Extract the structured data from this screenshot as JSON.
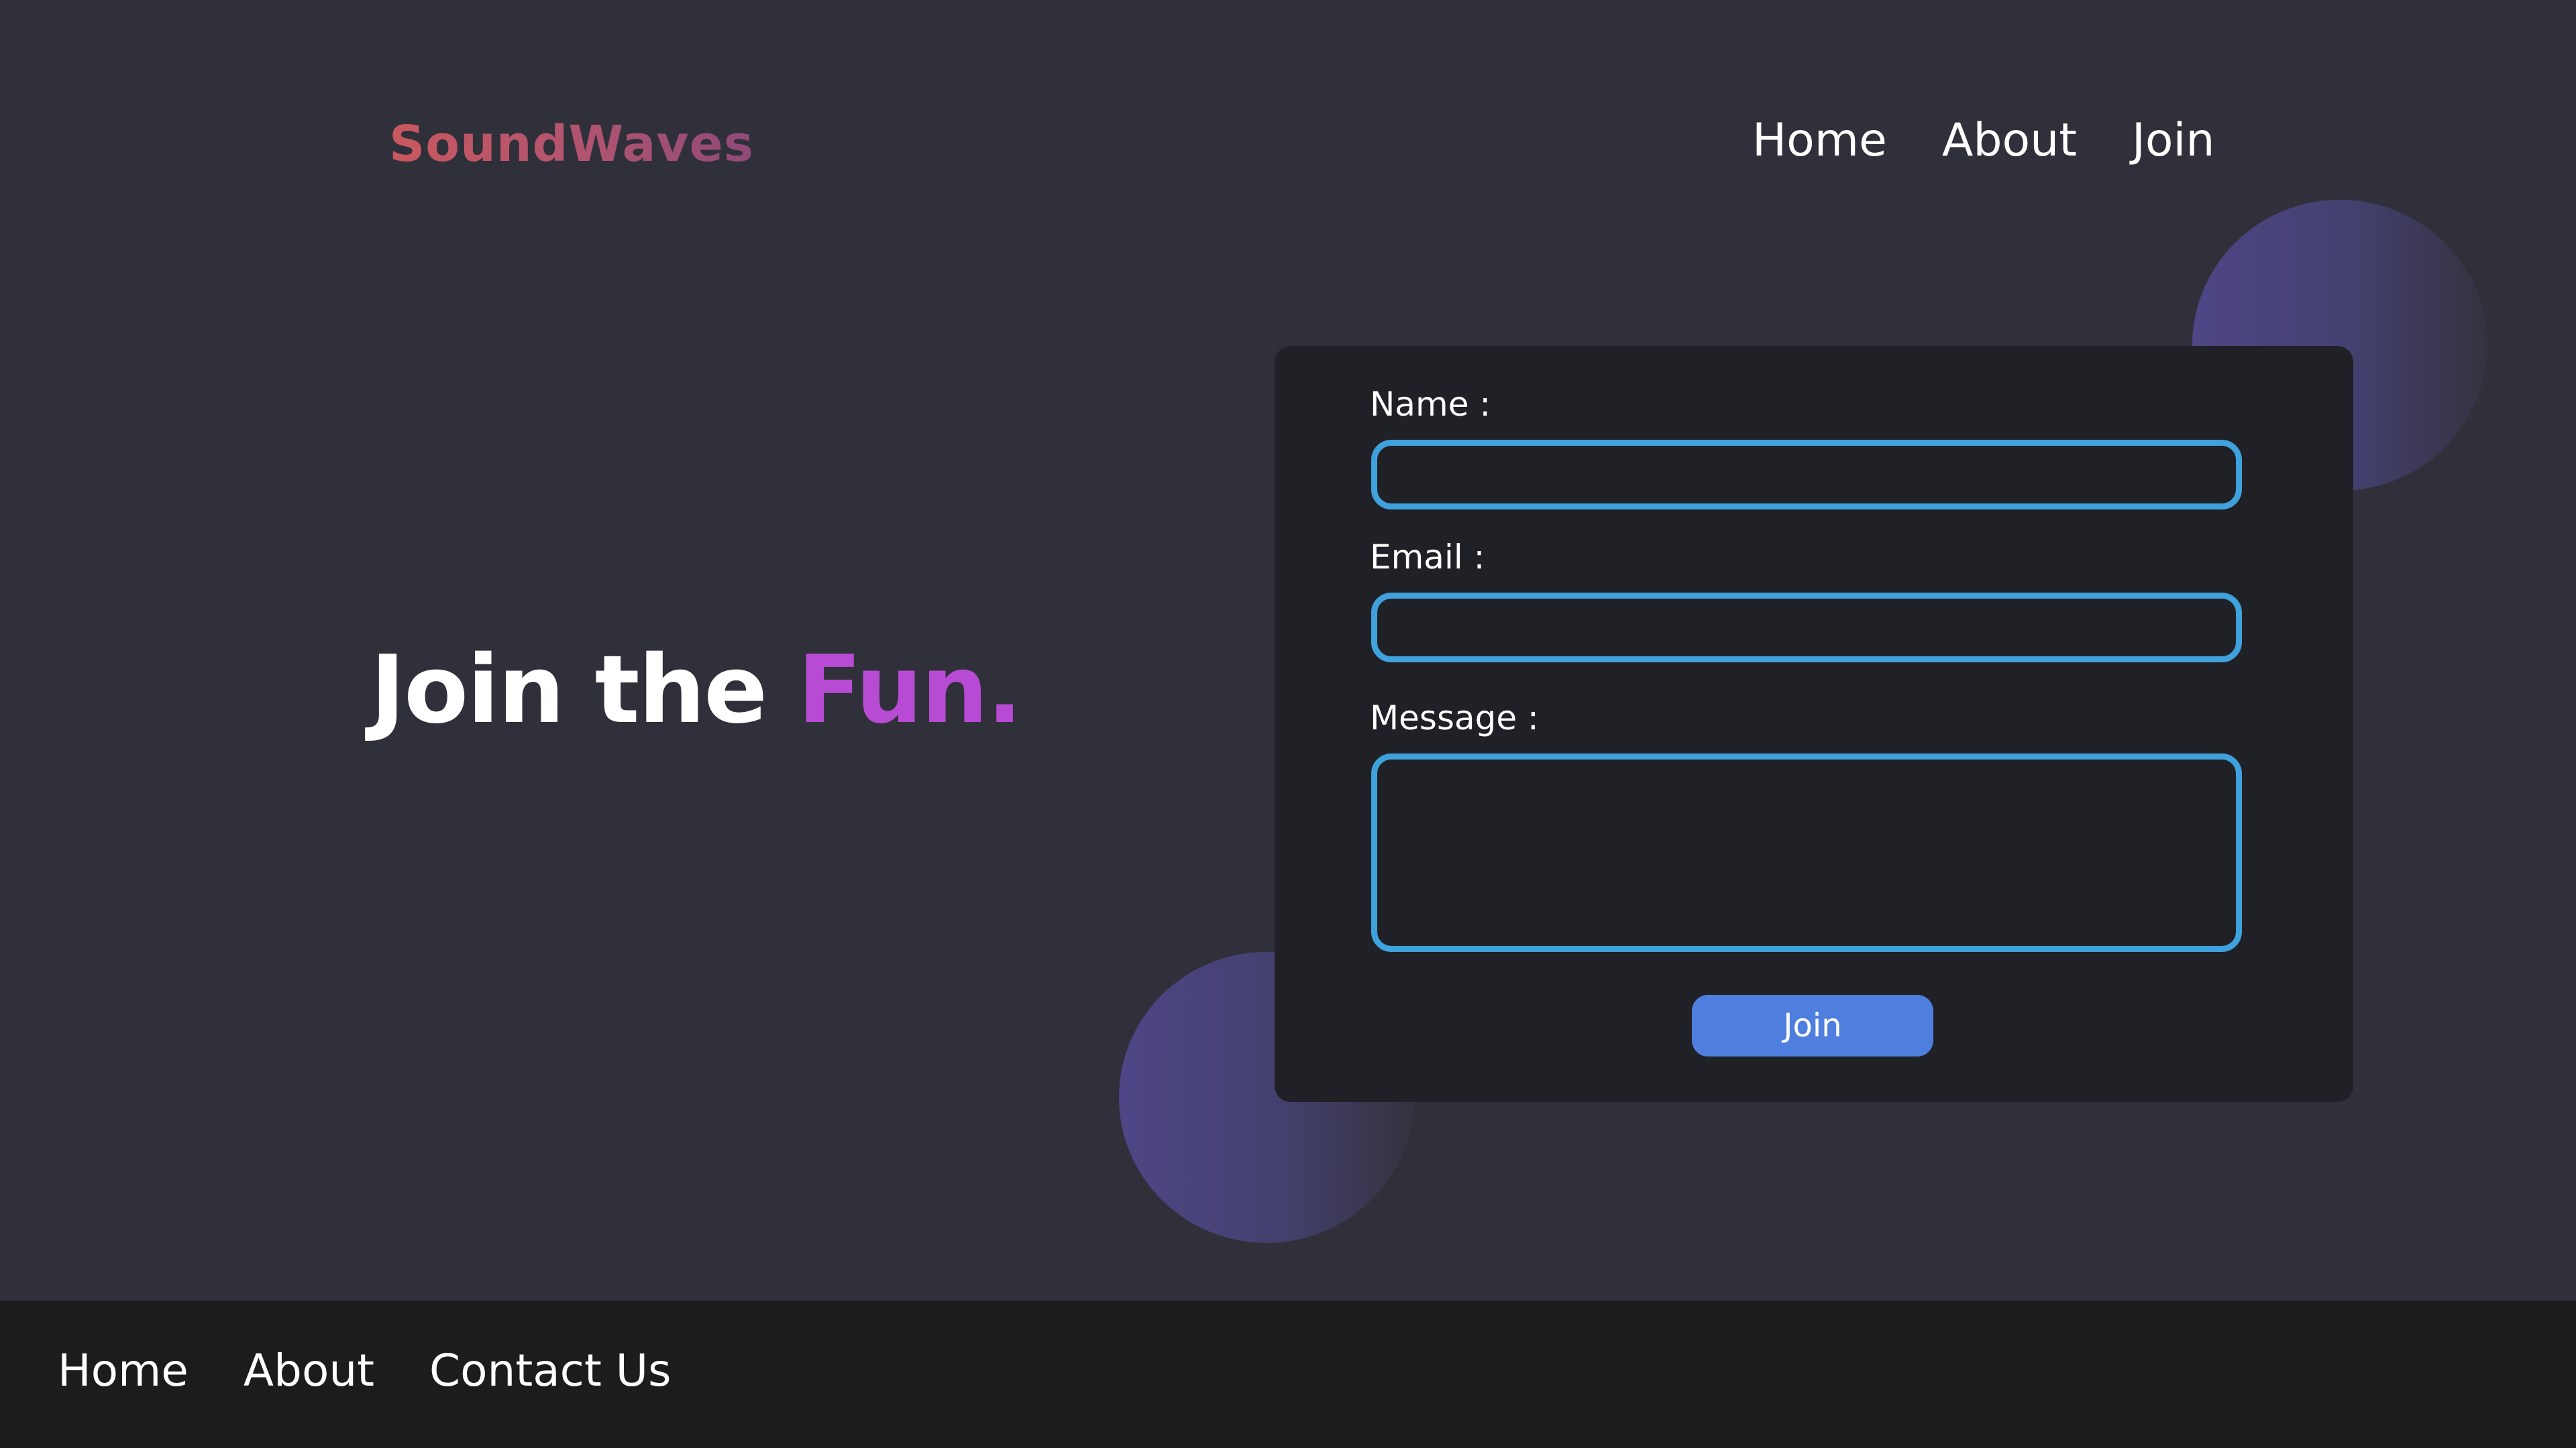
{
  "brand": {
    "name": "SoundWaves"
  },
  "header_nav": [
    {
      "label": "Home"
    },
    {
      "label": "About"
    },
    {
      "label": "Join"
    }
  ],
  "hero": {
    "prefix": "Join the ",
    "accent": "Fun."
  },
  "form": {
    "name_label": "Name :",
    "name_value": "",
    "email_label": "Email :",
    "email_value": "",
    "message_label": "Message :",
    "message_value": "",
    "submit_label": "Join"
  },
  "footer_nav": [
    {
      "label": "Home"
    },
    {
      "label": "About"
    },
    {
      "label": "Contact Us"
    }
  ],
  "colors": {
    "background": "#30303b",
    "card": "#202027",
    "footer": "#1c1c1d",
    "input_border": "#3fa2dc",
    "button": "#4f7fde",
    "accent": "#b84bd3",
    "brand_gradient_start": "#c9585e",
    "brand_gradient_end": "#8f4a78"
  }
}
